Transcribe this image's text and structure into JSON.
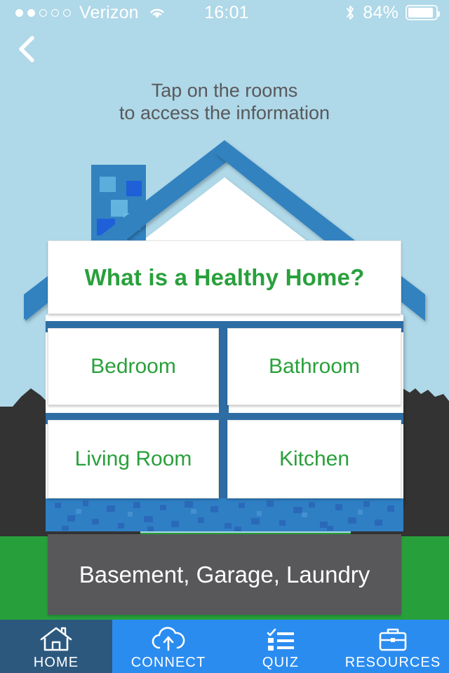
{
  "status_bar": {
    "signal_dots_total": 5,
    "signal_dots_filled": 2,
    "carrier": "Verizon",
    "wifi_icon": "wifi-icon",
    "time": "16:01",
    "bluetooth_icon": "bluetooth-icon",
    "battery_percent": "84%",
    "battery_level": 84
  },
  "nav": {
    "back_icon": "chevron-left-icon"
  },
  "instructions": {
    "line1": "Tap on the rooms",
    "line2": "to access the information"
  },
  "house": {
    "hero_label": "What is a Healthy Home?",
    "rooms": [
      {
        "label": "Bedroom"
      },
      {
        "label": "Bathroom"
      },
      {
        "label": "Living Room"
      },
      {
        "label": "Kitchen"
      }
    ],
    "basement_label": "Basement, Garage, Laundry"
  },
  "tabs": [
    {
      "label": "HOME",
      "icon": "house-icon",
      "active": true
    },
    {
      "label": "CONNECT",
      "icon": "cloud-upload-icon",
      "active": false
    },
    {
      "label": "QUIZ",
      "icon": "checklist-icon",
      "active": false
    },
    {
      "label": "RESOURCES",
      "icon": "briefcase-icon",
      "active": false
    }
  ],
  "colors": {
    "sky": "#AFD8E8",
    "grass": "#27A03C",
    "roof_blue": "#3282C0",
    "divider_blue": "#2E6DA4",
    "accent_green": "#29A03B",
    "basement_gray": "#58585A",
    "tab_blue": "#2B8CF0",
    "tab_active_blue": "#2C587E",
    "text_gray": "#58595B",
    "silhouette": "#333333"
  }
}
